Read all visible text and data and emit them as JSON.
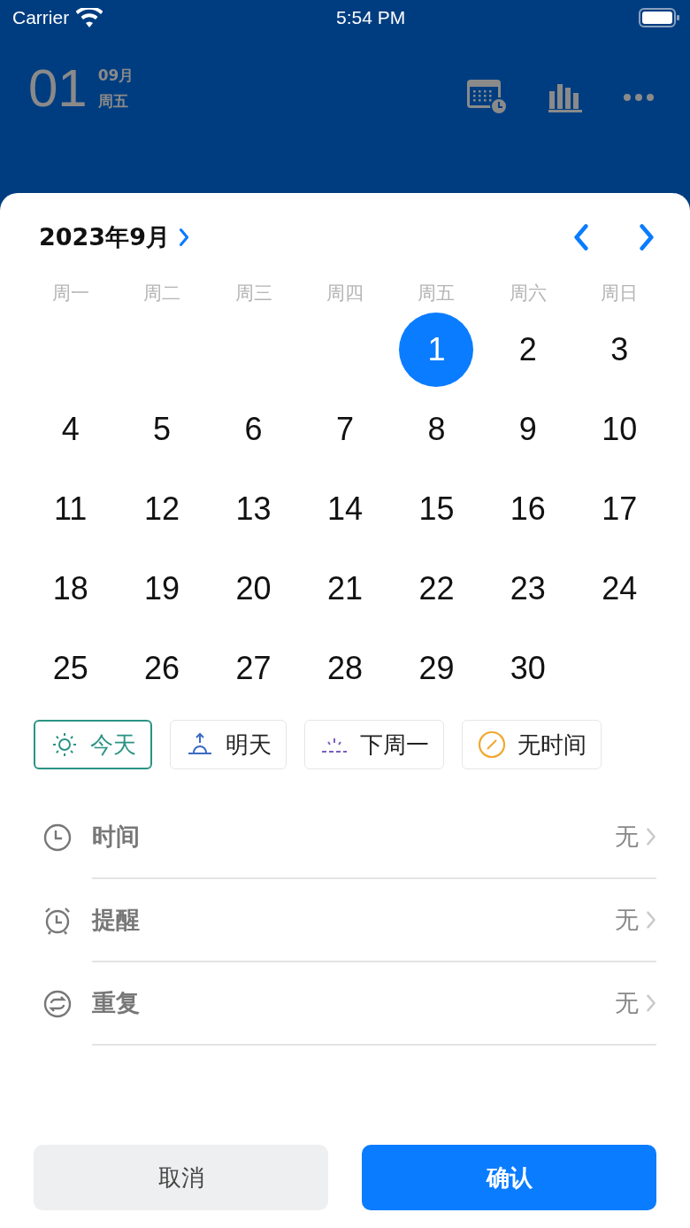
{
  "status_bar": {
    "carrier": "Carrier",
    "time": "5:54 PM"
  },
  "header": {
    "day": "01",
    "month": "09月",
    "weekday": "周五"
  },
  "sheet": {
    "month_title": "2023年9月",
    "weekdays": [
      "周一",
      "周二",
      "周三",
      "周四",
      "周五",
      "周六",
      "周日"
    ],
    "weeks": [
      [
        {
          "kind": "blank"
        },
        {
          "kind": "blank"
        },
        {
          "kind": "blank"
        },
        {
          "kind": "blank"
        },
        {
          "kind": "day",
          "label": "1",
          "selected": true
        },
        {
          "kind": "day",
          "label": "2",
          "selected": false
        },
        {
          "kind": "day",
          "label": "3",
          "selected": false
        }
      ],
      [
        {
          "kind": "day",
          "label": "4",
          "selected": false
        },
        {
          "kind": "day",
          "label": "5",
          "selected": false
        },
        {
          "kind": "day",
          "label": "6",
          "selected": false
        },
        {
          "kind": "day",
          "label": "7",
          "selected": false
        },
        {
          "kind": "day",
          "label": "8",
          "selected": false
        },
        {
          "kind": "day",
          "label": "9",
          "selected": false
        },
        {
          "kind": "day",
          "label": "10",
          "selected": false
        }
      ],
      [
        {
          "kind": "day",
          "label": "11",
          "selected": false
        },
        {
          "kind": "day",
          "label": "12",
          "selected": false
        },
        {
          "kind": "day",
          "label": "13",
          "selected": false
        },
        {
          "kind": "day",
          "label": "14",
          "selected": false
        },
        {
          "kind": "day",
          "label": "15",
          "selected": false
        },
        {
          "kind": "day",
          "label": "16",
          "selected": false
        },
        {
          "kind": "day",
          "label": "17",
          "selected": false
        }
      ],
      [
        {
          "kind": "day",
          "label": "18",
          "selected": false
        },
        {
          "kind": "day",
          "label": "19",
          "selected": false
        },
        {
          "kind": "day",
          "label": "20",
          "selected": false
        },
        {
          "kind": "day",
          "label": "21",
          "selected": false
        },
        {
          "kind": "day",
          "label": "22",
          "selected": false
        },
        {
          "kind": "day",
          "label": "23",
          "selected": false
        },
        {
          "kind": "day",
          "label": "24",
          "selected": false
        }
      ],
      [
        {
          "kind": "day",
          "label": "25",
          "selected": false
        },
        {
          "kind": "day",
          "label": "26",
          "selected": false
        },
        {
          "kind": "day",
          "label": "27",
          "selected": false
        },
        {
          "kind": "day",
          "label": "28",
          "selected": false
        },
        {
          "kind": "day",
          "label": "29",
          "selected": false
        },
        {
          "kind": "day",
          "label": "30",
          "selected": false
        },
        {
          "kind": "blank"
        }
      ]
    ],
    "quick_options": [
      {
        "kind": "sun",
        "label": "今天",
        "selected": true
      },
      {
        "kind": "sunrise",
        "label": "明天",
        "selected": false
      },
      {
        "kind": "dawn",
        "label": "下周一",
        "selected": false
      },
      {
        "kind": "none",
        "label": "无时间",
        "selected": false
      }
    ],
    "settings": [
      {
        "kind": "clock",
        "label": "时间",
        "value": "无"
      },
      {
        "kind": "alarm",
        "label": "提醒",
        "value": "无"
      },
      {
        "kind": "repeat",
        "label": "重复",
        "value": "无"
      }
    ],
    "buttons": [
      {
        "kind": "cancel",
        "label": "取消"
      },
      {
        "kind": "confirm",
        "label": "确认"
      }
    ]
  }
}
